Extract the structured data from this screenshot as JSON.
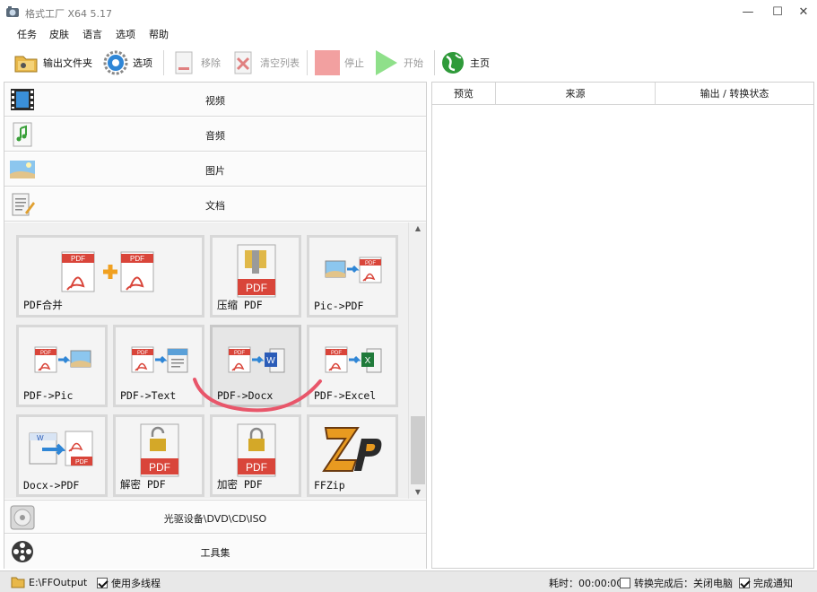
{
  "window": {
    "title": "格式工厂 X64 5.17",
    "controls": {
      "minimize": "—",
      "maximize": "☐",
      "close": "✕"
    }
  },
  "menu": [
    "任务",
    "皮肤",
    "语言",
    "选项",
    "帮助"
  ],
  "toolbar": {
    "output_folder": "输出文件夹",
    "options": "选项",
    "remove": "移除",
    "clear_list": "清空列表",
    "stop": "停止",
    "start": "开始",
    "home": "主页"
  },
  "categories": {
    "video": "视频",
    "audio": "音频",
    "image": "图片",
    "document": "文档",
    "disc": "光驱设备\\DVD\\CD\\ISO",
    "tools": "工具集"
  },
  "document_tools": [
    {
      "label": "PDF合并",
      "icon": "pdf-merge-icon"
    },
    {
      "label": "压缩 PDF",
      "icon": "pdf-compress-icon"
    },
    {
      "label": "Pic->PDF",
      "icon": "pic-to-pdf-icon"
    },
    {
      "label": "PDF->Pic",
      "icon": "pdf-to-pic-icon"
    },
    {
      "label": "PDF->Text",
      "icon": "pdf-to-text-icon"
    },
    {
      "label": "PDF->Docx",
      "icon": "pdf-to-docx-icon",
      "selected": true
    },
    {
      "label": "PDF->Excel",
      "icon": "pdf-to-excel-icon"
    },
    {
      "label": "Docx->PDF",
      "icon": "docx-to-pdf-icon"
    },
    {
      "label": "解密 PDF",
      "icon": "pdf-decrypt-icon"
    },
    {
      "label": "加密 PDF",
      "icon": "pdf-encrypt-icon"
    },
    {
      "label": "FFZip",
      "icon": "ffzip-icon"
    }
  ],
  "pdf_badge": "PDF",
  "task_table": {
    "columns": [
      "预览",
      "来源",
      "输出 / 转换状态"
    ]
  },
  "status": {
    "output_path": "E:\\FFOutput",
    "multithread_label": "使用多线程",
    "multithread_checked": true,
    "elapsed": "耗时：00:00:00",
    "after_complete_label": "转换完成后：关闭电脑",
    "after_complete_checked": false,
    "notify_label": "完成通知",
    "notify_checked": true
  },
  "colors": {
    "pdf_red": "#d9453a",
    "accent_blue": "#2f86d6",
    "start_green": "#8fe08a",
    "stop_red": "#f2a0a0",
    "annotation_pink": "#e8566a"
  }
}
